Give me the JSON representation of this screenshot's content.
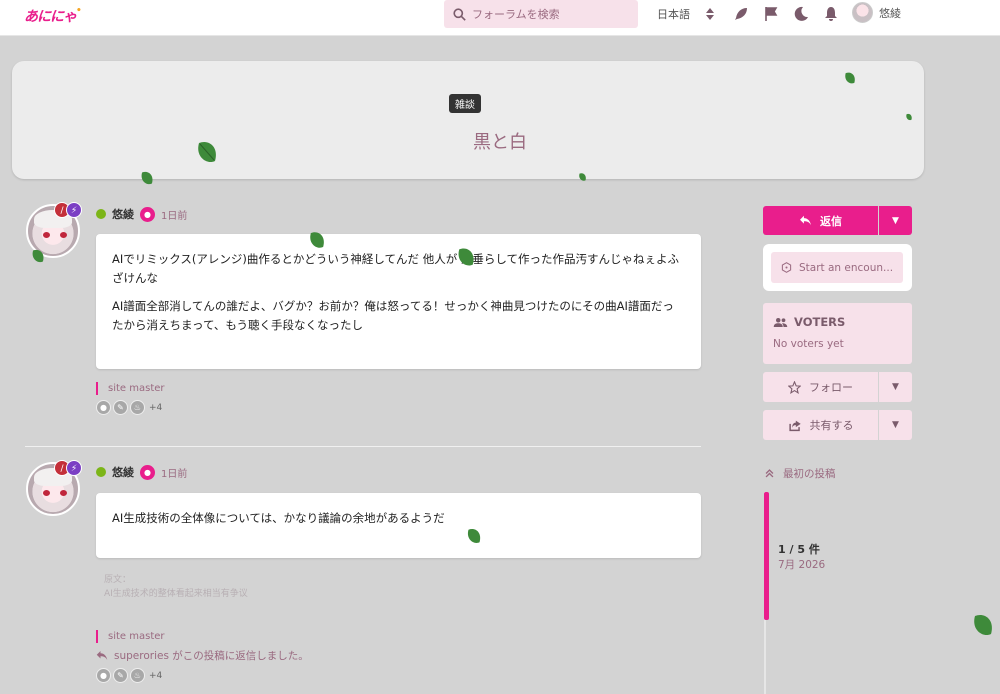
{
  "header": {
    "logo": "あににゃ",
    "logo_suffix": "•",
    "search_placeholder": "フォーラムを検索",
    "language": "日本語",
    "username": "悠綾"
  },
  "topic": {
    "category": "雑談",
    "title": "黒と白"
  },
  "posts": [
    {
      "author": "悠綾",
      "time": "1日前",
      "paragraphs": [
        "AIでリミックス(アレンジ)曲作るとかどういう神経してんだ 他人が 涎垂らして作った作品汚すんじゃねぇよふざけんな",
        "AI譜面全部消してんの誰だよ、バグか？お前か？俺は怒ってる！せっかく神曲見つけたのにその曲AI譜面だったから消えちまって、もう聴く手段なくなったし"
      ],
      "signature": "site master",
      "more_reactions": "+4"
    },
    {
      "author": "悠綾",
      "time": "1日前",
      "paragraphs": [
        "AI生成技術の全体像については、かなり議論の余地があるようだ"
      ],
      "quote_label": "原文：",
      "quote_text": "AI生成技术的整体看起来相当有争议",
      "signature": "site master",
      "replied_user": "superories",
      "replied_text": "がこの投稿に返信しました。",
      "more_reactions": "+4"
    }
  ],
  "sidebar": {
    "reply_label": "返信",
    "encounter_label": "Start an encoun...",
    "voters_title": "VOTERS",
    "voters_empty": "No voters yet",
    "follow_label": "フォロー",
    "share_label": "共有する",
    "first_post_label": "最初の投稿",
    "progress_count": "1 / 5 件",
    "progress_date": "7月 2026"
  },
  "colors": {
    "accent": "#e91e8c",
    "muted_text": "#9a6a80",
    "soft_pink": "#f7e1ea",
    "background": "#d3d3d3"
  },
  "icons": [
    "search-icon",
    "sort-icon",
    "feather-icon",
    "flag-icon",
    "moon-icon",
    "bell-icon",
    "reply-icon",
    "chevron-down-icon",
    "dice-icon",
    "users-icon",
    "star-icon",
    "share-icon",
    "chevrons-up-icon",
    "leaf-icon",
    "lightbulb-icon",
    "edit-icon",
    "fire-icon",
    "online-dot-icon"
  ]
}
